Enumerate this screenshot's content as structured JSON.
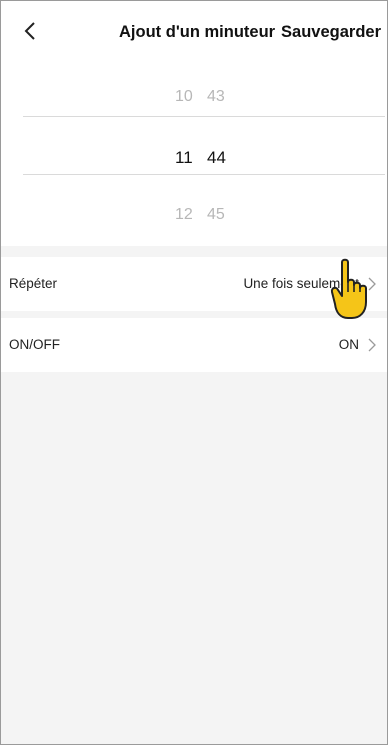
{
  "header": {
    "back_icon": "chevron-left-icon",
    "title": "Ajout d'un minuteur",
    "save_label": "Sauvegarder"
  },
  "picker": {
    "hours": [
      "10",
      "11",
      "12"
    ],
    "minutes": [
      "43",
      "44",
      "45"
    ],
    "selected_hour": "11",
    "selected_minute": "44"
  },
  "settings": {
    "repeat": {
      "label": "Répéter",
      "value": "Une fois seulement"
    },
    "onoff": {
      "label": "ON/OFF",
      "value": "ON"
    }
  },
  "overlay": {
    "icon": "pointing-hand-icon",
    "color": "#f5c518"
  }
}
